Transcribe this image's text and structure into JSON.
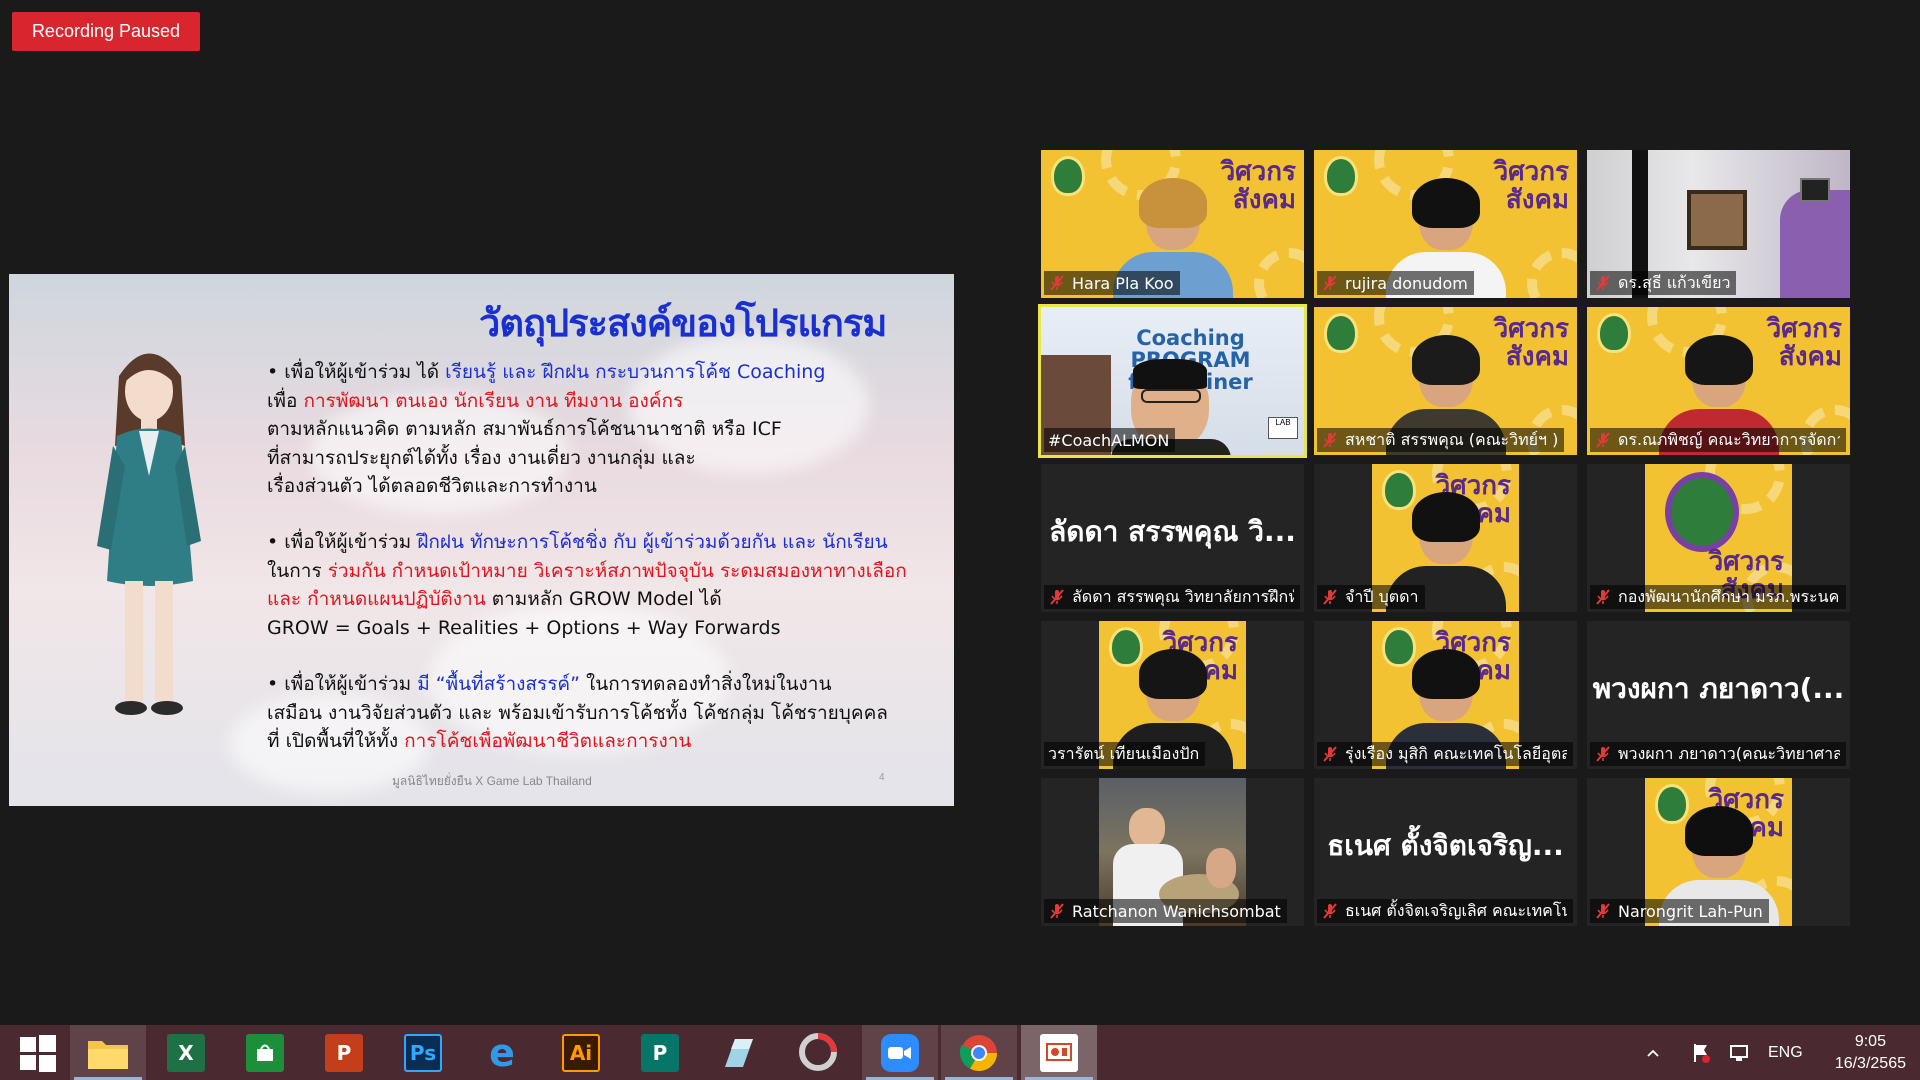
{
  "recording": {
    "label": "Recording Paused"
  },
  "slide": {
    "title": "วัตถุประสงค์ของโปรแกรม",
    "p1": [
      {
        "t": "• เพื่อให้ผู้เข้าร่วม ได้ ",
        "c": "k"
      },
      {
        "t": "เรียนรู้ และ ฝึกฝน กระบวนการโค้ช Coaching",
        "c": "b"
      },
      {
        "t": "\nเพื่อ ",
        "c": "k"
      },
      {
        "t": "การพัฒนา ตนเอง นักเรียน งาน ทีมงาน องค์กร",
        "c": "r"
      },
      {
        "t": "\nตามหลักแนวคิด ตามหลัก สมาพันธ์การโค้ชนานาชาติ หรือ ICF\nที่สามารถประยุกต์ได้ทั้ง เรื่อง งานเดี่ยว งานกลุ่ม และ\nเรื่องส่วนตัว ได้ตลอดชีวิตและการทำงาน",
        "c": "k"
      }
    ],
    "p2": [
      {
        "t": "• เพื่อให้ผู้เข้าร่วม ",
        "c": "k"
      },
      {
        "t": "ฝึกฝน ทักษะการโค้ชชิ่ง กับ ผู้เข้าร่วมด้วยกัน และ นักเรียน",
        "c": "b"
      },
      {
        "t": "\nในการ ",
        "c": "k"
      },
      {
        "t": "ร่วมกัน กำหนดเป้าหมาย วิเคราะห์สภาพปัจจุบัน ระดมสมองหาทางเลือก\nและ กำหนดแผนปฏิบัติงาน",
        "c": "r"
      },
      {
        "t": " ตามหลัก GROW Model ได้\nGROW = Goals + Realities + Options + Way Forwards",
        "c": "k"
      }
    ],
    "p3": [
      {
        "t": "• เพื่อให้ผู้เข้าร่วม ",
        "c": "k"
      },
      {
        "t": "มี “พื้นที่สร้างสรรค์”",
        "c": "b"
      },
      {
        "t": " ในการทดลองทำสิ่งใหม่ในงาน\nเสมือน งานวิจัยส่วนตัว และ พร้อมเข้ารับการโค้ชทั้ง โค้ชกลุ่ม โค้ชรายบุคคล\nที่ เปิดพื้นที่ให้ทั้ง ",
        "c": "k"
      },
      {
        "t": "การโค้ชเพื่อพัฒนาชีวิตและการงาน",
        "c": "r"
      }
    ],
    "footer": "มูลนิธิไทยยั่งยืน X Game Lab Thailand",
    "page_number": "4"
  },
  "banner_text": "วิศวกร\nสังคม",
  "coach_banner": "Coaching PROGRAM\nfor Trainer",
  "participants": [
    {
      "name": "Hara Pla Koo",
      "muted": true,
      "kind": "video",
      "hair": "#c8913b",
      "shirt": "#6e9fd1"
    },
    {
      "name": "rujira donudom",
      "muted": true,
      "kind": "video",
      "hair": "#111111",
      "shirt": "#f4f4f4"
    },
    {
      "name": "ดร.สุธี แก้วเขียว",
      "muted": true,
      "kind": "room"
    },
    {
      "name": "#CoachALMON",
      "muted": false,
      "kind": "coach",
      "active": true
    },
    {
      "name": "สหชาติ สรรพคุณ (คณะวิทย์ฯ )",
      "muted": true,
      "kind": "video",
      "hair": "#1b1b1b",
      "shirt": "#3f3a2e"
    },
    {
      "name": "ดร.ณภพิชญ์ คณะวิทยาการจัดการ",
      "muted": true,
      "kind": "video",
      "hair": "#161616",
      "shirt": "#c0292f"
    },
    {
      "name": "ลัดดา สรรพคุณ วิทยาลัยการฝึกหัดครู",
      "muted": true,
      "kind": "text",
      "big": "ลัดดา สรรพคุณ วิ..."
    },
    {
      "name": "จำปี บุตดา",
      "muted": true,
      "kind": "mid",
      "hair": "#111111",
      "shirt": "#222222"
    },
    {
      "name": "กองพัฒนานักศึกษา มรภ.พระนคร",
      "muted": true,
      "kind": "logo"
    },
    {
      "name": "วรารัตน์ เทียนเมืองปัก",
      "muted": false,
      "kind": "mid",
      "hair": "#151515",
      "shirt": "#1e1e1e"
    },
    {
      "name": "รุ่งเรือง มุสิกิ คณะเทคโนโลยีอุตสาหกรรม",
      "muted": true,
      "kind": "mid",
      "hair": "#111111",
      "shirt": "#2b2f3a"
    },
    {
      "name": "พวงผกา ภยาดาว(คณะวิทยาศาสตร์)",
      "muted": true,
      "kind": "text",
      "big": "พวงผกา ภยาดาว(..."
    },
    {
      "name": "Ratchanon Wanichsombat",
      "muted": true,
      "kind": "photo"
    },
    {
      "name": "ธเนศ ตั้งจิตเจริญเลิศ คณะเทคโนโลยีอุตสาหกรรม",
      "muted": true,
      "kind": "text",
      "big": "ธเนศ ตั้งจิตเจริญ..."
    },
    {
      "name": "Narongrit Lah-Pun",
      "muted": true,
      "kind": "mid",
      "hair": "#0f0f0f",
      "shirt": "#e8e8e8"
    }
  ],
  "taskbar": {
    "apps": [
      {
        "name": "start",
        "label": ""
      },
      {
        "name": "file-explorer",
        "label": ""
      },
      {
        "name": "excel",
        "label": "X"
      },
      {
        "name": "store",
        "label": ""
      },
      {
        "name": "powerpoint",
        "label": "P"
      },
      {
        "name": "photoshop",
        "label": "Ps"
      },
      {
        "name": "internet-explorer",
        "label": "e"
      },
      {
        "name": "illustrator",
        "label": "Ai"
      },
      {
        "name": "publisher",
        "label": "P"
      },
      {
        "name": "notes",
        "label": ""
      },
      {
        "name": "photoscape",
        "label": ""
      },
      {
        "name": "zoom",
        "label": ""
      },
      {
        "name": "chrome",
        "label": ""
      },
      {
        "name": "presenter",
        "label": ""
      }
    ],
    "language": "ENG",
    "time": "9:05",
    "date": "16/3/2565"
  },
  "colors": {
    "recording": "#d9252d",
    "taskbar": "#4a2a30",
    "active_speaker": "#e7e74a",
    "tile_bg": "#f2c232"
  }
}
